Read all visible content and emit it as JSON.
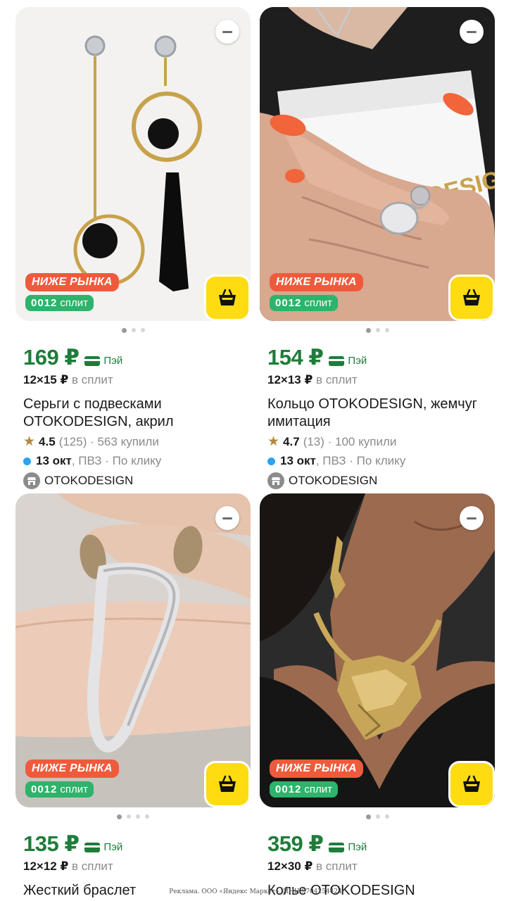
{
  "products": [
    {
      "badge_market": "НИЖЕ РЫНКА",
      "split_num": "0012",
      "split_label": "сплит",
      "price": "169 ₽",
      "pay_label": "Пэй",
      "split_amount": "12×15 ₽",
      "split_suffix": "в сплит",
      "title": "Серьги с подвесками OTOKODESIGN, акрил",
      "rating": "4.5",
      "rating_meta": "(125) · 563 купили",
      "delivery_date": "13 окт",
      "delivery_meta": ", ПВЗ · По клику",
      "seller": "OTOKODESIGN",
      "slides": 3,
      "active_slide": 0
    },
    {
      "badge_market": "НИЖЕ РЫНКА",
      "split_num": "0012",
      "split_label": "сплит",
      "price": "154 ₽",
      "pay_label": "Пэй",
      "split_amount": "12×13 ₽",
      "split_suffix": "в сплит",
      "title": "Кольцо OTOKODESIGN, жемчуг имитация",
      "rating": "4.7",
      "rating_meta": "(13) · 100 купили",
      "delivery_date": "13 окт",
      "delivery_meta": ", ПВЗ · По клику",
      "seller": "OTOKODESIGN",
      "slides": 3,
      "active_slide": 0,
      "photo_text": "OTOKODESIGN"
    },
    {
      "badge_market": "НИЖЕ РЫНКА",
      "split_num": "0012",
      "split_label": "сплит",
      "price": "135 ₽",
      "pay_label": "Пэй",
      "split_amount": "12×12 ₽",
      "split_suffix": "в сплит",
      "title": "Жесткий браслет",
      "slides": 4,
      "active_slide": 0
    },
    {
      "badge_market": "НИЖЕ РЫНКА",
      "split_num": "0012",
      "split_label": "сплит",
      "price": "359 ₽",
      "pay_label": "Пэй",
      "split_amount": "12×30 ₽",
      "split_suffix": "в сплит",
      "title": "Колье OTOKODESIGN",
      "slides": 3,
      "active_slide": 0
    }
  ],
  "footer": {
    "ad_text": "Реклама. ООО «Яндекс Маркет». ИНН 9704254424"
  },
  "colors": {
    "price_green": "#1e7d3a",
    "badge_orange": "#f05a3c",
    "split_green": "#2db36b",
    "cart_yellow": "#ffdb12",
    "delivery_blue": "#2aa3f0",
    "star_gold": "#b08a3a"
  },
  "icons": {
    "remove": "minus-circle-icon",
    "cart": "shopping-basket-icon",
    "pay": "card-icon",
    "rating": "star-icon",
    "delivery": "dot-icon",
    "seller": "shop-icon"
  }
}
